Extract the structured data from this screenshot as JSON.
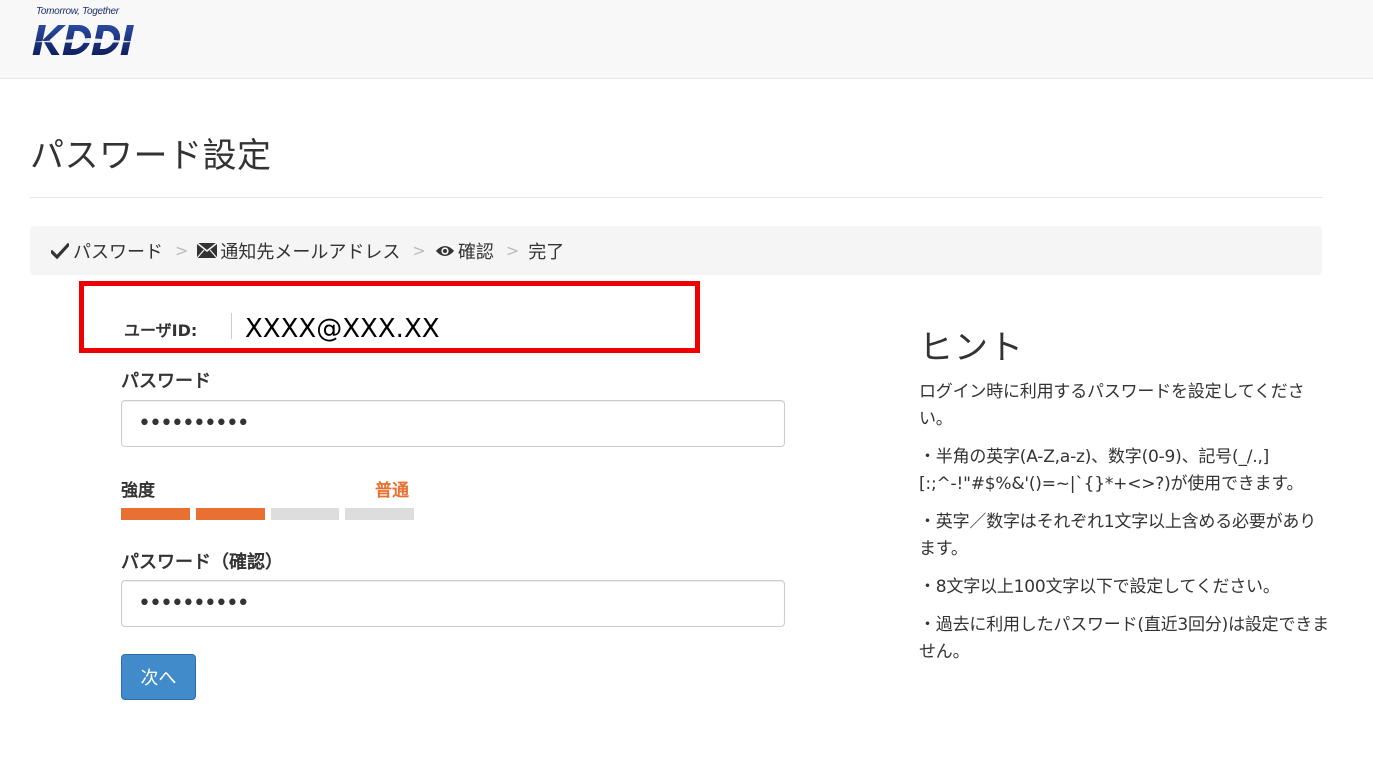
{
  "brand": {
    "tagline": "Tomorrow, Together",
    "logo_text": "KDDI",
    "logo_color": "#1a2c6b"
  },
  "page": {
    "title": "パスワード設定"
  },
  "breadcrumb": {
    "steps": [
      {
        "icon": "checkmark-icon",
        "label": "パスワード"
      },
      {
        "icon": "envelope-icon",
        "label": "通知先メールアドレス"
      },
      {
        "icon": "eye-icon",
        "label": "確認"
      },
      {
        "icon": "",
        "label": "完了"
      }
    ],
    "separator": ">"
  },
  "form": {
    "user_id_label": "ユーザID:",
    "user_id_value": "XXXX@XXX.XX",
    "password_label": "パスワード",
    "password_value": "••••••••••",
    "strength_label": "強度",
    "strength_value": "普通",
    "strength_color": "#e87032",
    "strength_level": 2,
    "strength_max": 4,
    "confirm_label": "パスワード（確認）",
    "confirm_value": "••••••••••",
    "next_button": "次へ",
    "button_color": "#428bca"
  },
  "hint": {
    "title": "ヒント",
    "paragraphs": [
      "ログイン時に利用するパスワードを設定してください。",
      "・半角の英字(A-Z,a-z)、数字(0-9)、記号(_/.,][:;^-!\"#$%&'()=~|`{}*+<>?)が使用できます。",
      "・英字／数字はそれぞれ1文字以上含める必要があります。",
      "・8文字以上100文字以下で設定してください。",
      "・過去に利用したパスワード(直近3回分)は設定できません。"
    ]
  },
  "highlight_color": "#ee0000"
}
